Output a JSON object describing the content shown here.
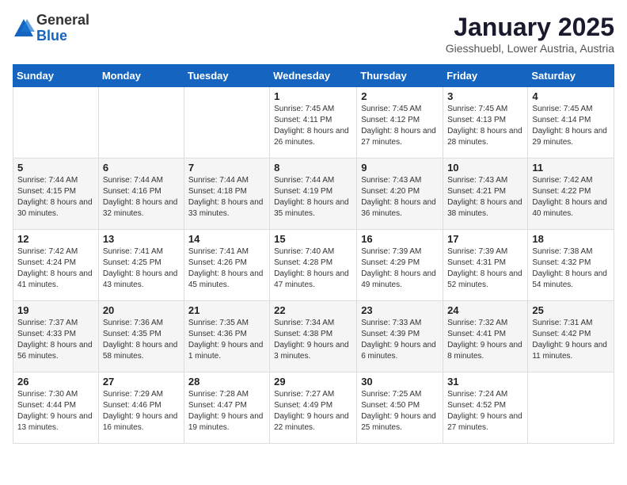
{
  "header": {
    "logo_general": "General",
    "logo_blue": "Blue",
    "month_title": "January 2025",
    "location": "Giesshuebl, Lower Austria, Austria"
  },
  "weekdays": [
    "Sunday",
    "Monday",
    "Tuesday",
    "Wednesday",
    "Thursday",
    "Friday",
    "Saturday"
  ],
  "weeks": [
    [
      {
        "day": "",
        "info": ""
      },
      {
        "day": "",
        "info": ""
      },
      {
        "day": "",
        "info": ""
      },
      {
        "day": "1",
        "info": "Sunrise: 7:45 AM\nSunset: 4:11 PM\nDaylight: 8 hours and 26 minutes."
      },
      {
        "day": "2",
        "info": "Sunrise: 7:45 AM\nSunset: 4:12 PM\nDaylight: 8 hours and 27 minutes."
      },
      {
        "day": "3",
        "info": "Sunrise: 7:45 AM\nSunset: 4:13 PM\nDaylight: 8 hours and 28 minutes."
      },
      {
        "day": "4",
        "info": "Sunrise: 7:45 AM\nSunset: 4:14 PM\nDaylight: 8 hours and 29 minutes."
      }
    ],
    [
      {
        "day": "5",
        "info": "Sunrise: 7:44 AM\nSunset: 4:15 PM\nDaylight: 8 hours and 30 minutes."
      },
      {
        "day": "6",
        "info": "Sunrise: 7:44 AM\nSunset: 4:16 PM\nDaylight: 8 hours and 32 minutes."
      },
      {
        "day": "7",
        "info": "Sunrise: 7:44 AM\nSunset: 4:18 PM\nDaylight: 8 hours and 33 minutes."
      },
      {
        "day": "8",
        "info": "Sunrise: 7:44 AM\nSunset: 4:19 PM\nDaylight: 8 hours and 35 minutes."
      },
      {
        "day": "9",
        "info": "Sunrise: 7:43 AM\nSunset: 4:20 PM\nDaylight: 8 hours and 36 minutes."
      },
      {
        "day": "10",
        "info": "Sunrise: 7:43 AM\nSunset: 4:21 PM\nDaylight: 8 hours and 38 minutes."
      },
      {
        "day": "11",
        "info": "Sunrise: 7:42 AM\nSunset: 4:22 PM\nDaylight: 8 hours and 40 minutes."
      }
    ],
    [
      {
        "day": "12",
        "info": "Sunrise: 7:42 AM\nSunset: 4:24 PM\nDaylight: 8 hours and 41 minutes."
      },
      {
        "day": "13",
        "info": "Sunrise: 7:41 AM\nSunset: 4:25 PM\nDaylight: 8 hours and 43 minutes."
      },
      {
        "day": "14",
        "info": "Sunrise: 7:41 AM\nSunset: 4:26 PM\nDaylight: 8 hours and 45 minutes."
      },
      {
        "day": "15",
        "info": "Sunrise: 7:40 AM\nSunset: 4:28 PM\nDaylight: 8 hours and 47 minutes."
      },
      {
        "day": "16",
        "info": "Sunrise: 7:39 AM\nSunset: 4:29 PM\nDaylight: 8 hours and 49 minutes."
      },
      {
        "day": "17",
        "info": "Sunrise: 7:39 AM\nSunset: 4:31 PM\nDaylight: 8 hours and 52 minutes."
      },
      {
        "day": "18",
        "info": "Sunrise: 7:38 AM\nSunset: 4:32 PM\nDaylight: 8 hours and 54 minutes."
      }
    ],
    [
      {
        "day": "19",
        "info": "Sunrise: 7:37 AM\nSunset: 4:33 PM\nDaylight: 8 hours and 56 minutes."
      },
      {
        "day": "20",
        "info": "Sunrise: 7:36 AM\nSunset: 4:35 PM\nDaylight: 8 hours and 58 minutes."
      },
      {
        "day": "21",
        "info": "Sunrise: 7:35 AM\nSunset: 4:36 PM\nDaylight: 9 hours and 1 minute."
      },
      {
        "day": "22",
        "info": "Sunrise: 7:34 AM\nSunset: 4:38 PM\nDaylight: 9 hours and 3 minutes."
      },
      {
        "day": "23",
        "info": "Sunrise: 7:33 AM\nSunset: 4:39 PM\nDaylight: 9 hours and 6 minutes."
      },
      {
        "day": "24",
        "info": "Sunrise: 7:32 AM\nSunset: 4:41 PM\nDaylight: 9 hours and 8 minutes."
      },
      {
        "day": "25",
        "info": "Sunrise: 7:31 AM\nSunset: 4:42 PM\nDaylight: 9 hours and 11 minutes."
      }
    ],
    [
      {
        "day": "26",
        "info": "Sunrise: 7:30 AM\nSunset: 4:44 PM\nDaylight: 9 hours and 13 minutes."
      },
      {
        "day": "27",
        "info": "Sunrise: 7:29 AM\nSunset: 4:46 PM\nDaylight: 9 hours and 16 minutes."
      },
      {
        "day": "28",
        "info": "Sunrise: 7:28 AM\nSunset: 4:47 PM\nDaylight: 9 hours and 19 minutes."
      },
      {
        "day": "29",
        "info": "Sunrise: 7:27 AM\nSunset: 4:49 PM\nDaylight: 9 hours and 22 minutes."
      },
      {
        "day": "30",
        "info": "Sunrise: 7:25 AM\nSunset: 4:50 PM\nDaylight: 9 hours and 25 minutes."
      },
      {
        "day": "31",
        "info": "Sunrise: 7:24 AM\nSunset: 4:52 PM\nDaylight: 9 hours and 27 minutes."
      },
      {
        "day": "",
        "info": ""
      }
    ]
  ]
}
